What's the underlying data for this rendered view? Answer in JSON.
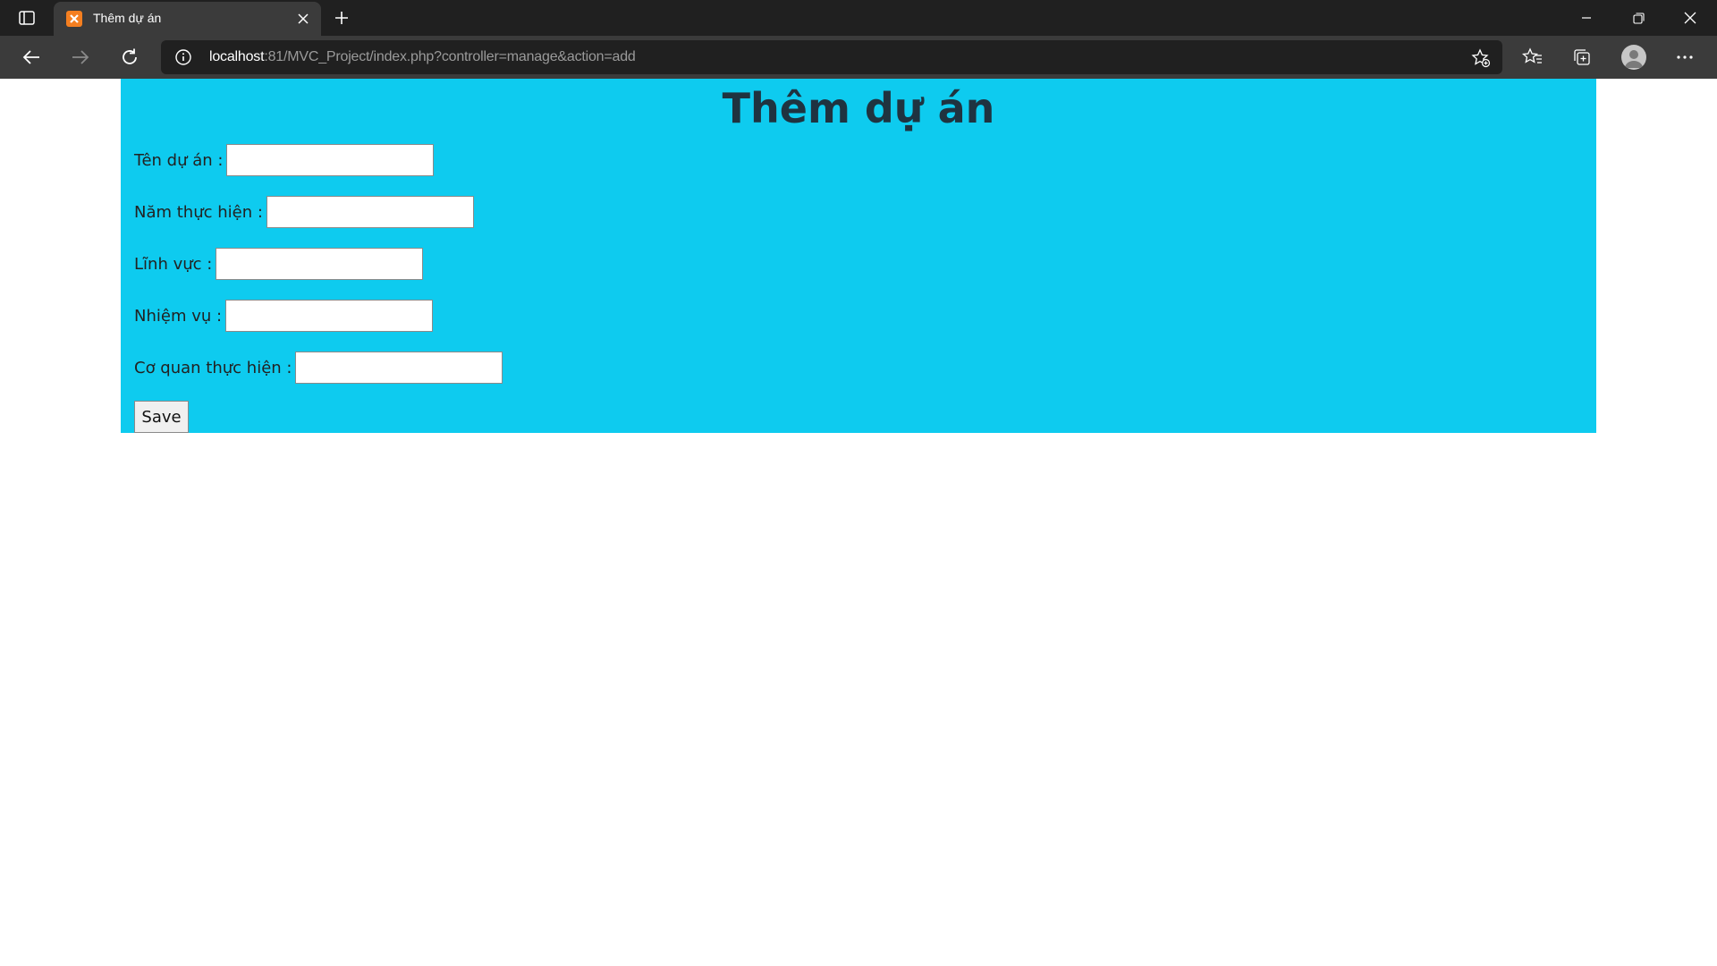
{
  "browser": {
    "tab_title": "Thêm dự án",
    "url_host": "localhost",
    "url_rest": ":81/MVC_Project/index.php?controller=manage&action=add"
  },
  "page": {
    "title": "Thêm dự án",
    "fields": [
      {
        "label": "Tên dự án :",
        "value": ""
      },
      {
        "label": "Năm thực hiện :",
        "value": ""
      },
      {
        "label": "Lĩnh vực :",
        "value": ""
      },
      {
        "label": "Nhiệm vụ :",
        "value": ""
      },
      {
        "label": "Cơ quan thực hiện :",
        "value": ""
      }
    ],
    "save_label": "Save",
    "background_color": "#0ecbef"
  }
}
